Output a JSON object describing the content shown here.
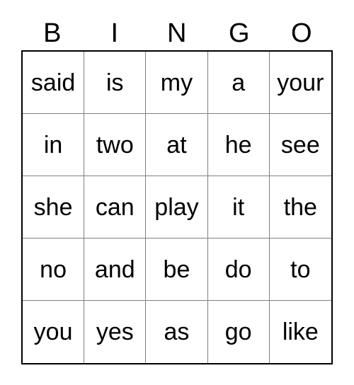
{
  "card": {
    "title": "BINGO",
    "columns": [
      "B",
      "I",
      "N",
      "G",
      "O"
    ],
    "rows": [
      {
        "cells": [
          "said",
          "is",
          "my",
          "a",
          "your"
        ]
      },
      {
        "cells": [
          "in",
          "two",
          "at",
          "he",
          "see"
        ]
      },
      {
        "cells": [
          "she",
          "can",
          "play",
          "it",
          "the"
        ]
      },
      {
        "cells": [
          "no",
          "and",
          "be",
          "do",
          "to"
        ]
      },
      {
        "cells": [
          "you",
          "yes",
          "as",
          "go",
          "like"
        ]
      }
    ],
    "colors": {
      "text": "#000000",
      "background": "#ffffff",
      "outer_border": "#000000",
      "inner_border": "#808080"
    }
  }
}
